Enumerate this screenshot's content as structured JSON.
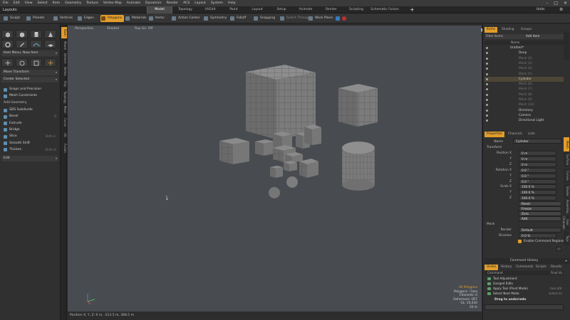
{
  "menubar": {
    "items": [
      "File",
      "Edit",
      "View",
      "Select",
      "Item",
      "Geometry",
      "Texture",
      "Vertex Map",
      "Animate",
      "Dynamics",
      "Render",
      "ACS",
      "Layout",
      "System",
      "Help"
    ],
    "window_controls": [
      "–",
      "□",
      "✕"
    ]
  },
  "tabbar": {
    "layout_label": "Layouts",
    "workspaces": [
      "Model",
      "Topology",
      "UVEdit",
      "Paint",
      "Layout",
      "Setup",
      "Animate",
      "Render",
      "Scripting",
      "Schematic Fusion"
    ],
    "active": "Model",
    "plus": "+",
    "units": "Units",
    "gear": "⚙"
  },
  "toolbar": {
    "sculpt": "Sculpt",
    "presets": "Presets",
    "vertices": "Vertices",
    "edges": "Edges",
    "polygons": "Polygons",
    "materials": "Materials",
    "items": "Items",
    "action_center": "Action Center",
    "symmetry": "Symmetry",
    "falloff": "Falloff",
    "snapping": "Snapping",
    "select_through": "Select Through",
    "work_plane": "Work Plane"
  },
  "left": {
    "item_menu": "Item Menu: New Item",
    "move_transform": "Move Transform",
    "center_selected": "Center Selected",
    "snaps_precision": "Snaps and Precision",
    "mesh_constraints": "Mesh Constraints",
    "add_geometry": "Add Geometry",
    "tools": [
      {
        "label": "SDS Subdivide",
        "hot": ""
      },
      {
        "label": "Bevel",
        "hot": "B"
      },
      {
        "label": "Extrude",
        "hot": ""
      },
      {
        "label": "Bridge",
        "hot": ""
      },
      {
        "label": "Slice",
        "hot": "Shift+C"
      },
      {
        "label": "Smooth Shift",
        "hot": ""
      },
      {
        "label": "Thicken",
        "hot": "Shift+D"
      }
    ],
    "edit": "Edit",
    "vtabs": [
      "Basic",
      "Model",
      "Deform",
      "Vertex",
      "Poly",
      "Topology",
      "Mesh",
      "Curve",
      "UV",
      "Fusion"
    ]
  },
  "viewport": {
    "view_type": "Perspective",
    "shading": "Shaded",
    "ray_gl": "Ray GL: Off",
    "info": {
      "all_polygons": "All Polygons",
      "selection": "Polygons : Face",
      "channels": "Channels: 0",
      "deformers": "Deformers: OFF",
      "gl": "GL: 24,434",
      "distance": "20 m"
    }
  },
  "status": {
    "position": "Position X, Y, Z:  0 m, -213.5 m, 368.5 m"
  },
  "outliner": {
    "tabs": [
      "Items",
      "Shading",
      "Groups"
    ],
    "filter_label": "Filter Items",
    "add_item": "Add Item",
    "column": "Name",
    "rows": [
      {
        "name": "Untitled*",
        "indent": 0,
        "sel": false,
        "dim": false
      },
      {
        "name": "Deep",
        "indent": 1,
        "sel": false,
        "dim": false
      },
      {
        "name": "Mesh (2)",
        "indent": 1,
        "sel": false,
        "dim": true
      },
      {
        "name": "Mesh (3)",
        "indent": 1,
        "sel": false,
        "dim": true
      },
      {
        "name": "Mesh (4)",
        "indent": 1,
        "sel": false,
        "dim": true
      },
      {
        "name": "Mesh (5)",
        "indent": 1,
        "sel": false,
        "dim": true
      },
      {
        "name": "Cylinder",
        "indent": 1,
        "sel": true,
        "dim": false
      },
      {
        "name": "Mesh (6)",
        "indent": 1,
        "sel": false,
        "dim": true
      },
      {
        "name": "Mesh (7)",
        "indent": 1,
        "sel": false,
        "dim": true
      },
      {
        "name": "Mesh (8)",
        "indent": 1,
        "sel": false,
        "dim": true
      },
      {
        "name": "Mesh (9)",
        "indent": 1,
        "sel": false,
        "dim": true
      },
      {
        "name": "Mesh (10)",
        "indent": 1,
        "sel": false,
        "dim": true
      },
      {
        "name": "Directory",
        "indent": 1,
        "sel": false,
        "dim": false
      },
      {
        "name": "Camera",
        "indent": 1,
        "sel": false,
        "dim": false
      },
      {
        "name": "Directional Light",
        "indent": 1,
        "sel": false,
        "dim": false
      }
    ]
  },
  "properties": {
    "tabs": [
      "Properties",
      "Channels",
      "Lists"
    ],
    "name_label": "Name",
    "name_value": "Cylinder",
    "transform_label": "Transform",
    "position_label": "Position X",
    "rotation_label": "Rotation X",
    "scale_label": "Scale X",
    "y_label": "Y",
    "z_label": "Z",
    "position": [
      "0 m",
      "0 m",
      "0 m"
    ],
    "rotation": [
      "0.0 °",
      "0.0 °",
      "0.0 °"
    ],
    "scale": [
      "100.0 %",
      "100.0 %",
      "100.0 %"
    ],
    "reset": "Reset",
    "freeze": "Freeze",
    "zero": "Zero",
    "add": "Add",
    "mesh_label": "Mesh",
    "render_label": "Render",
    "render_value": "Default",
    "dissolve_label": "Dissolve",
    "dissolve_value": "0.0 %",
    "enable_cmd": "Enable Command Regions",
    "rvtabs": [
      "Mesh",
      "Surface",
      "Curves",
      "Shader",
      "Assembly",
      "User Channels",
      "Tags"
    ]
  },
  "history": {
    "title": "Command History",
    "tabs": [
      "Undos",
      "History",
      "Commands",
      "Scripts",
      "Results"
    ],
    "col_command": "Command",
    "col_final": "Final Va",
    "rows": [
      {
        "label": "Tool Adjustment",
        "right": ""
      },
      {
        "label": "Ganged Edits",
        "right": ""
      },
      {
        "label": "Apply Tool (Pivot Mode)",
        "right": "tool.attr"
      },
      {
        "label": "Select Next Mode",
        "right": "select.ne"
      }
    ],
    "drag_hint": "Drag to undo/redo"
  }
}
